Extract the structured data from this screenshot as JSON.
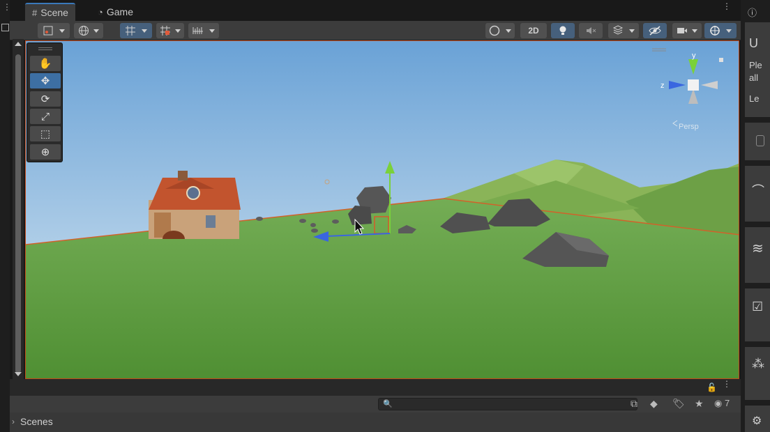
{
  "tabs": [
    {
      "label": "Scene",
      "icon": "hash-icon",
      "active": true
    },
    {
      "label": "Game",
      "icon": "gamepad-icon",
      "active": false
    }
  ],
  "toolbar": {
    "twod_label": "2D",
    "icons_left": [
      "draw-mode-icon",
      "global-icon",
      "grid-snap-icon",
      "grid-increment-icon",
      "rulers-icon"
    ],
    "icons_right": [
      "shading-icon",
      "lighting-icon",
      "audio-icon",
      "effects-icon",
      "visibility-icon",
      "camera-icon",
      "gizmos-icon"
    ]
  },
  "tools": [
    "hand-tool",
    "move-tool",
    "rotate-tool",
    "scale-tool",
    "rect-tool",
    "transform-tool"
  ],
  "active_tool": "move-tool",
  "gizmo": {
    "y_label": "y",
    "z_label": "z",
    "projection_label": "Persp"
  },
  "right_panel": {
    "text_1": "U",
    "text_2": "Ple",
    "text_3": "all",
    "text_4": "Le"
  },
  "hierarchy": {
    "search_placeholder": "",
    "hidden_count": "7",
    "scenes_label": "Scenes"
  },
  "colors": {
    "accent": "#3a79bb",
    "sky_top": "#6aa2d6",
    "ground": "#5f9f43",
    "selection_outline": "#c34a1b"
  }
}
